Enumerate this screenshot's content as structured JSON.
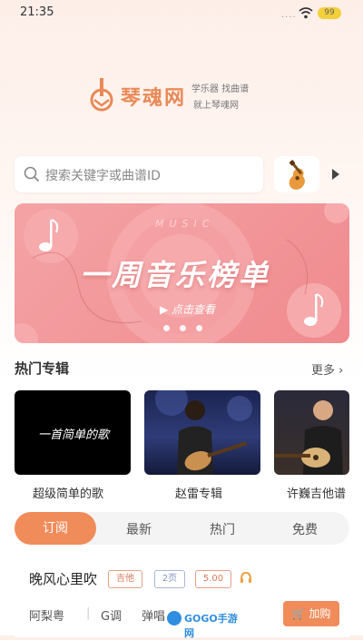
{
  "statusbar": {
    "time": "21:35",
    "battery": "99"
  },
  "logo": {
    "brand": "琴魂网",
    "slogan_line1": "学乐器 找曲谱",
    "slogan_line2": "就上琴魂网"
  },
  "search": {
    "placeholder": "搜索关键字或曲谱ID"
  },
  "banner": {
    "title": "一周音乐榜单",
    "music_word": "MUSIC",
    "cta": "点击查看"
  },
  "hot_albums": {
    "title": "热门专辑",
    "more": "更多",
    "items": [
      {
        "label": "超级简单的歌",
        "cover_text": "一首简单的歌"
      },
      {
        "label": "赵雷专辑"
      },
      {
        "label": "许巍吉他谱"
      }
    ]
  },
  "tabs": [
    "订阅",
    "最新",
    "热门",
    "免费"
  ],
  "song": {
    "title": "晚风心里吹",
    "tag_instrument": "吉他",
    "tag_pages": "2页",
    "tag_price": "5.00",
    "artist": "阿梨粤",
    "key": "G调",
    "style": "弹唱",
    "add_label": "加购"
  },
  "watermark": {
    "text": "GOGO手游网"
  },
  "colors": {
    "accent": "#f08c5a",
    "banner": "#f08a8e"
  }
}
